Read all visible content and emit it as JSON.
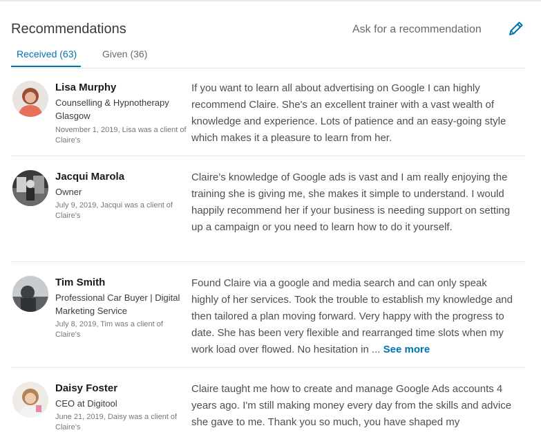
{
  "header": {
    "title": "Recommendations",
    "ask_label": "Ask for a recommendation",
    "edit_icon": "pencil-icon"
  },
  "tabs": [
    {
      "label": "Received (63)",
      "active": true
    },
    {
      "label": "Given (36)",
      "active": false
    }
  ],
  "colors": {
    "accent": "#0073b1",
    "divider": "#e6e9ec"
  },
  "recommendations": [
    {
      "name": "Lisa Murphy",
      "headline": "Counselling & Hypnotherapy Glasgow",
      "meta": "November 1, 2019, Lisa was a client of Claire's",
      "text": "If you want to learn all about advertising on Google I can highly recommend Claire. She's an excellent trainer with a vast wealth of knowledge and experience. Lots of patience and an easy-going style which makes it a pleasure to learn from her."
    },
    {
      "name": "Jacqui Marola",
      "headline": "Owner",
      "meta": "July 9, 2019, Jacqui was a client of Claire's",
      "text": "Claire’s knowledge of Google ads is vast and I am really enjoying the training she is giving me, she makes it simple to understand. I would happily recommend her if your business is needing support on setting up a campaign or you need to learn how to do it yourself."
    },
    {
      "name": "Tim Smith",
      "headline": "Professional Car Buyer | Digital Marketing Service",
      "meta": "July 8, 2019, Tim was a client of Claire's",
      "text": "Found Claire via a google and media search and can only speak highly of her services. Took the trouble to establish my knowledge and then tailored a plan moving forward. Very happy with the progress to date. She has been very flexible and rearranged time slots when my work load over flowed. No hesitation in ...",
      "see_more": "See more"
    },
    {
      "name": "Daisy Foster",
      "headline": "CEO at Digitool",
      "meta": "June 21, 2019, Daisy was a client of Claire's",
      "text": "Claire taught me how to create and manage Google Ads accounts 4 years ago. I'm still making money every day from the skills and advice she gave to me. Thank you so much, you have shaped my"
    }
  ]
}
